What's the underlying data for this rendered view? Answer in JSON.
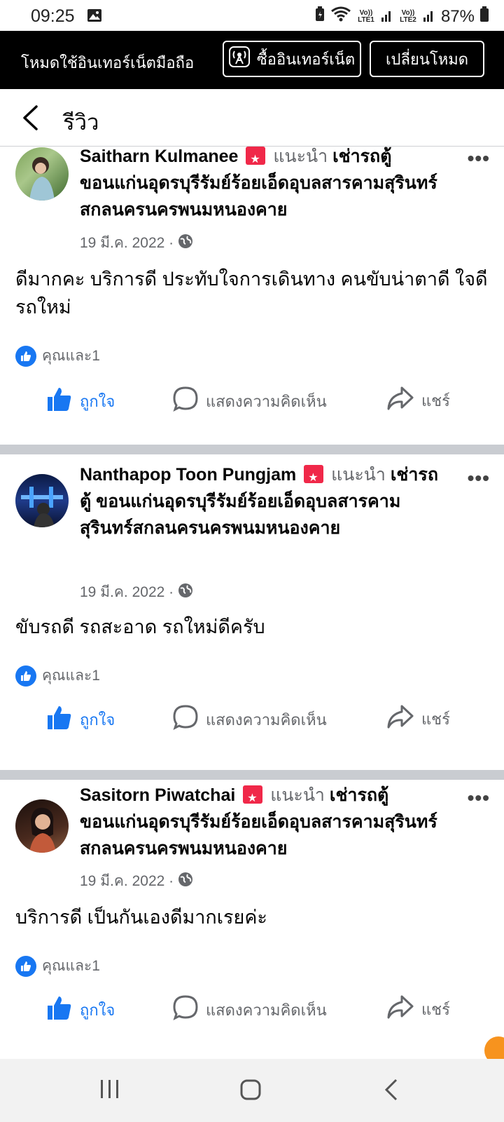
{
  "status_bar": {
    "time": "09:25",
    "net1": "Vo)) LTE1",
    "net2": "Vo)) LTE2",
    "battery": "87%"
  },
  "banner": {
    "text": "โหมดใช้อินเทอร์เน็ตมือถือ",
    "buy_label": "ซื้ออินเทอร์เน็ต",
    "switch_label": "เปลี่ยนโหมด"
  },
  "header": {
    "title": "รีวิว"
  },
  "posts": [
    {
      "author": "Saitharn Kulmanee",
      "recommend": "แนะนำ",
      "page": "เช่ารถตู้ ขอนแก่นอุดรบุรีรัมย์ร้อยเอ็ดอุบลสารคามสุรินทร์สกลนครนครพนมหนองคาย",
      "date": "19 มี.ค. 2022 ·",
      "text": "ดีมากคะ บริการดี ประทับใจการเดินทาง คนขับน่าตาดี ใจดี รถใหม่",
      "reactions": "คุณและ1",
      "like": "ถูกใจ",
      "comment": "แสดงความคิดเห็น",
      "share": "แชร์"
    },
    {
      "author": "Nanthapop Toon Pungjam",
      "recommend": "แนะนำ",
      "page": "เช่ารถตู้ ขอนแก่นอุดรบุรีรัมย์ร้อยเอ็ดอุบลสารคามสุรินทร์สกลนครนครพนมหนองคาย",
      "date": "19 มี.ค. 2022 ·",
      "text": "ขับรถดี รถสะอาด รถใหม่ดีครับ",
      "reactions": "คุณและ1",
      "like": "ถูกใจ",
      "comment": "แสดงความคิดเห็น",
      "share": "แชร์"
    },
    {
      "author": "Sasitorn Piwatchai",
      "recommend": "แนะนำ",
      "page": "เช่ารถตู้ ขอนแก่นอุดรบุรีรัมย์ร้อยเอ็ดอุบลสารคามสุรินทร์สกลนครนครพนมหนองคาย",
      "date": "19 มี.ค. 2022 ·",
      "text": "บริการดี เป็นกันเองดีมากเรยค่ะ",
      "reactions": "คุณและ1",
      "like": "ถูกใจ",
      "comment": "แสดงความคิดเห็น",
      "share": "แชร์"
    }
  ],
  "colors": {
    "accent": "#1877f2",
    "recommend_flag": "#f02849",
    "separator": "#c9ccd1",
    "banner_bg": "#000000"
  }
}
